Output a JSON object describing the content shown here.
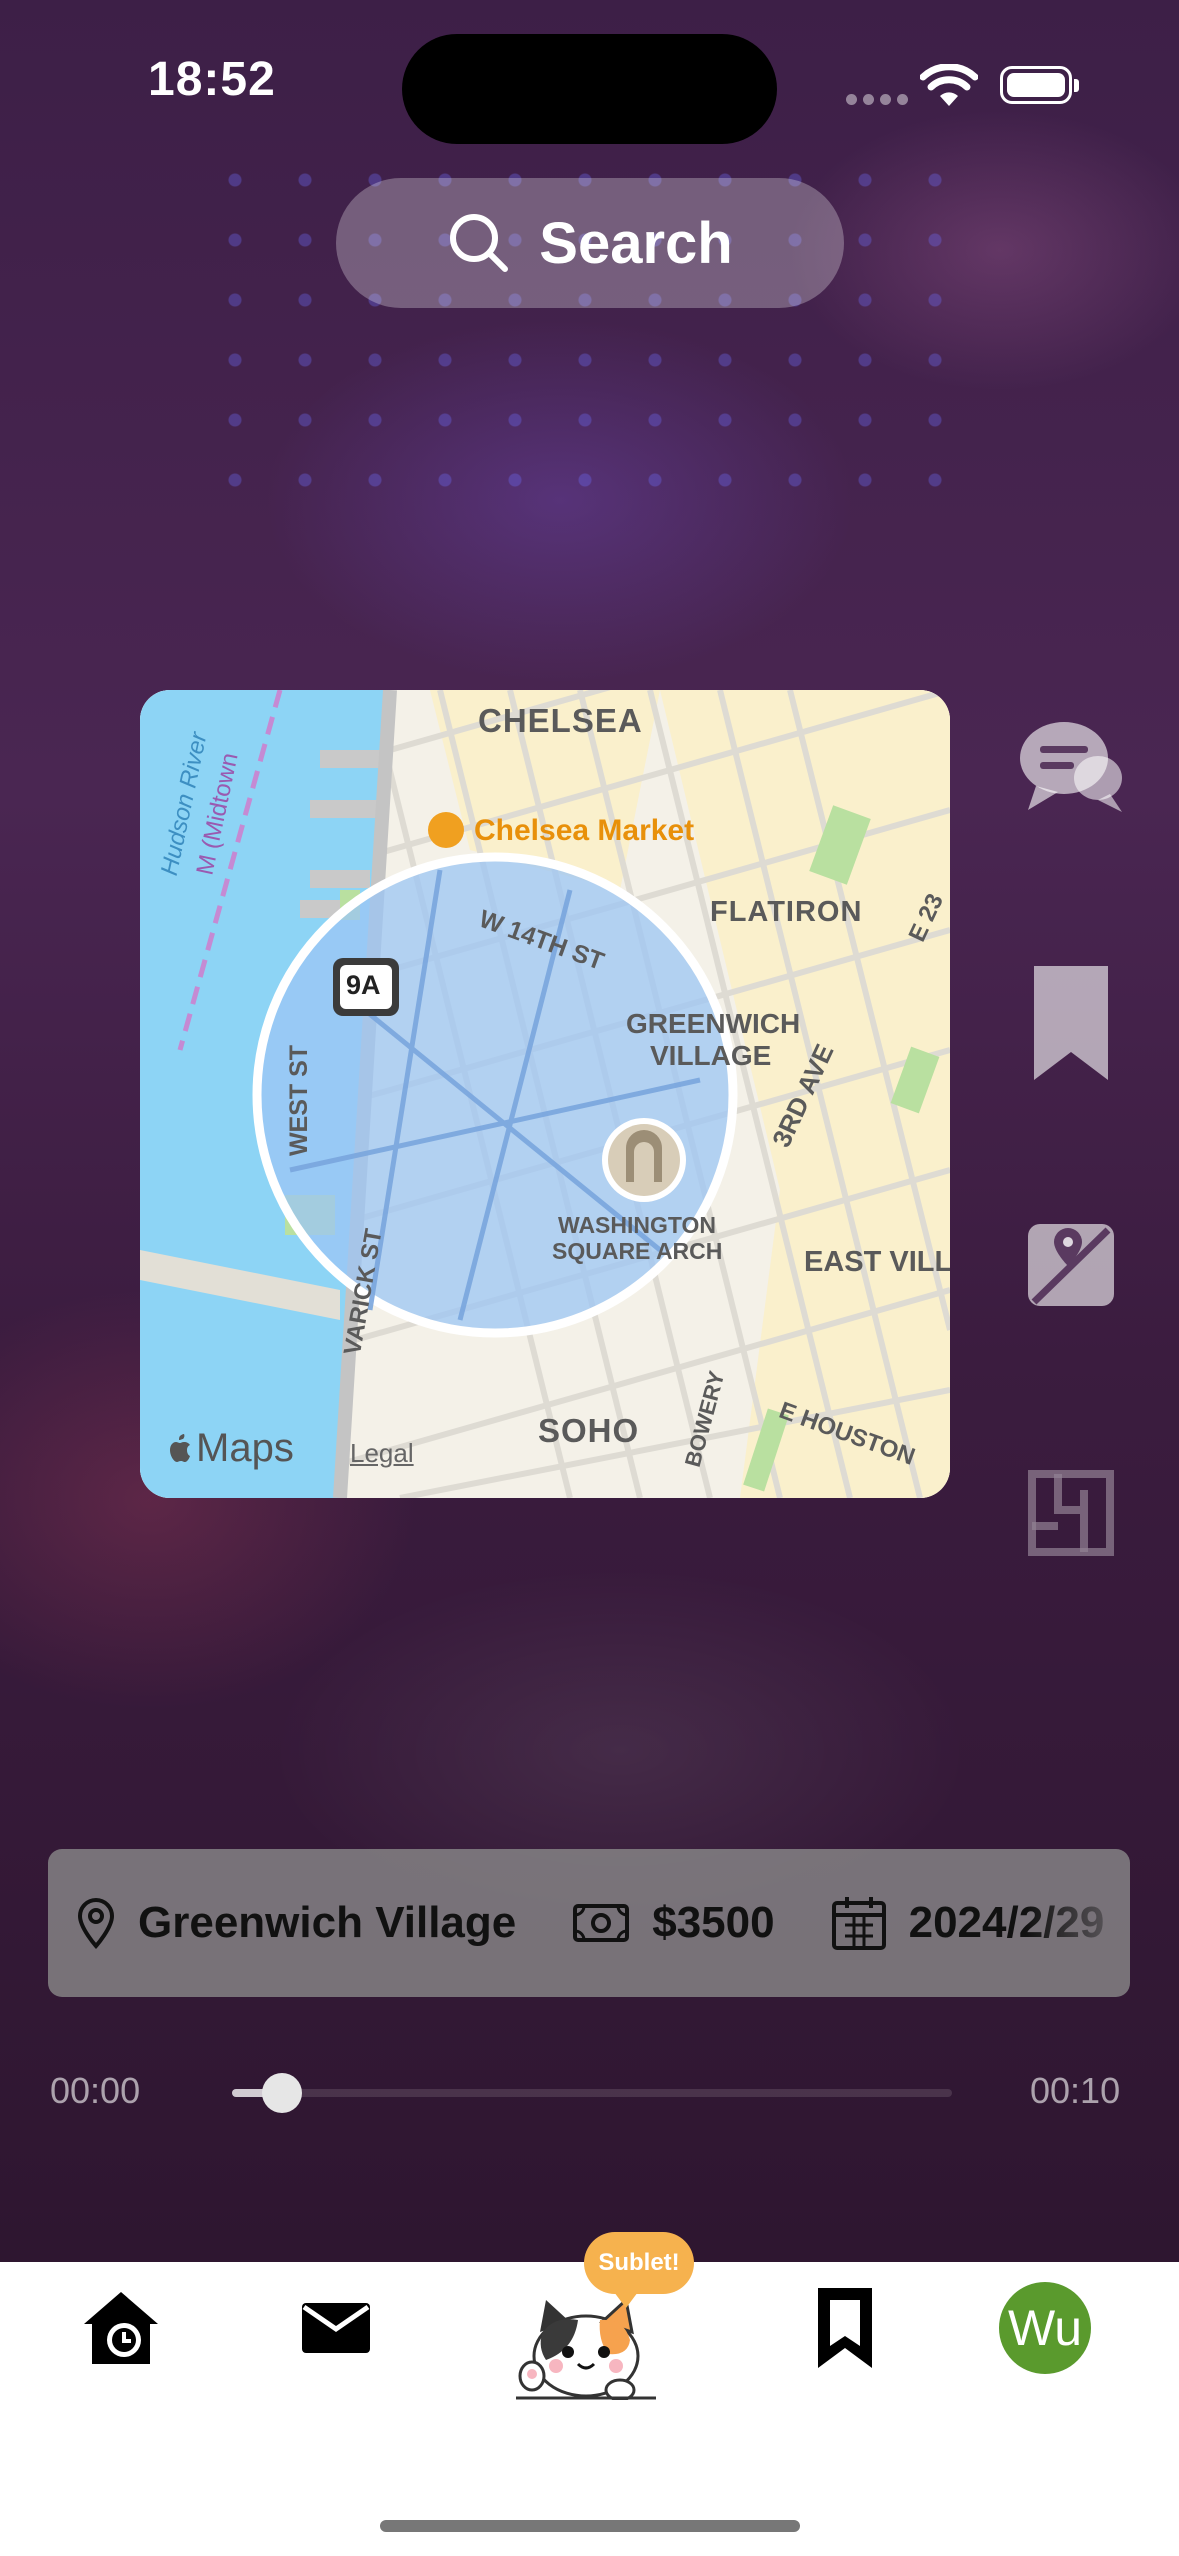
{
  "status_bar": {
    "time": "18:52"
  },
  "search": {
    "label": "Search"
  },
  "map": {
    "neighborhoods": [
      "CHELSEA",
      "FLATIRON",
      "GREENWICH VILLAGE",
      "EAST VILLA",
      "SOHO"
    ],
    "labels": {
      "chelsea": "CHELSEA",
      "chelsea_market": "Chelsea Market",
      "flatiron": "FLATIRON",
      "e23": "E 23",
      "w14": "W 14TH ST",
      "greenwich_1": "GREENWICH",
      "greenwich_2": "VILLAGE",
      "third_ave": "3RD AVE",
      "west_st": "WEST ST",
      "wsa_1": "WASHINGTON",
      "wsa_2": "SQUARE ARCH",
      "east_villa": "EAST VILLA",
      "varick": "VARICK ST",
      "e_houston": "E HOUSTON",
      "bowery": "BOWERY",
      "soho": "SOHO",
      "hudson": "Hudson River",
      "midtown": "M (Midtown",
      "route": "9A"
    },
    "attribution": {
      "brand": "Maps",
      "legal": "Legal"
    }
  },
  "info": {
    "location": "Greenwich Village",
    "price": "$3500",
    "date": "2024/2/29"
  },
  "playback": {
    "current": "00:00",
    "duration": "00:10",
    "progress": 0.05
  },
  "tabbar": {
    "bubble": "Sublet!",
    "avatar_initials": "Wu"
  },
  "colors": {
    "avatar": "#5a9a2d",
    "bubble": "#f6b24e",
    "map_water": "#8dd4f5",
    "map_circle": "#9cc5f4"
  }
}
